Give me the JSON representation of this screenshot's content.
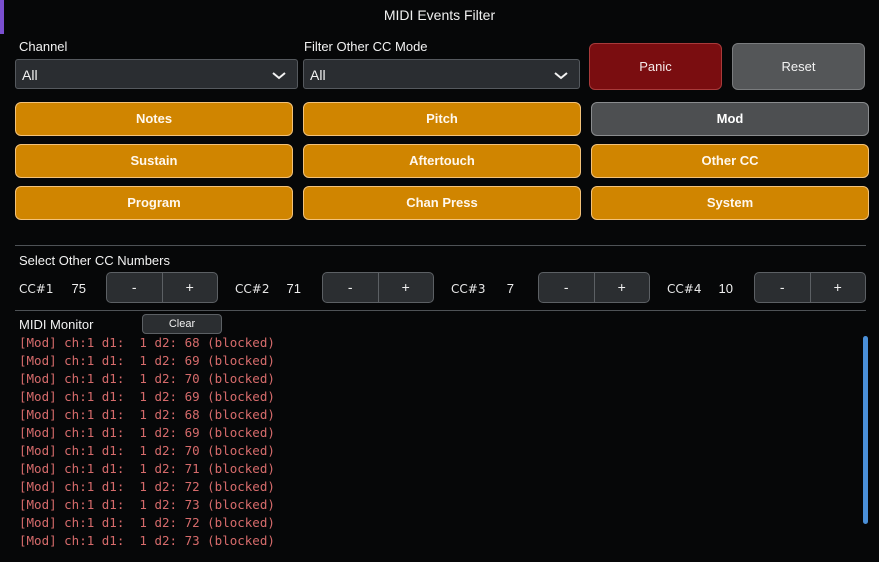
{
  "window": {
    "title": "MIDI Events Filter"
  },
  "channel": {
    "label": "Channel",
    "value": "All"
  },
  "cc_mode": {
    "label": "Filter Other CC Mode",
    "value": "All"
  },
  "actions": {
    "panic": "Panic",
    "reset": "Reset"
  },
  "toggles": [
    {
      "label": "Notes",
      "state": "on"
    },
    {
      "label": "Pitch",
      "state": "on"
    },
    {
      "label": "Mod",
      "state": "off"
    },
    {
      "label": "Sustain",
      "state": "on"
    },
    {
      "label": "Aftertouch",
      "state": "on"
    },
    {
      "label": "Other CC",
      "state": "on"
    },
    {
      "label": "Program",
      "state": "on"
    },
    {
      "label": "Chan Press",
      "state": "on"
    },
    {
      "label": "System",
      "state": "on"
    }
  ],
  "cc_section": {
    "title": "Select Other CC Numbers",
    "items": [
      {
        "label": "CC#1",
        "value": "75"
      },
      {
        "label": "CC#2",
        "value": "71"
      },
      {
        "label": "CC#3",
        "value": "7"
      },
      {
        "label": "CC#4",
        "value": "10"
      }
    ],
    "minus": "-",
    "plus": "+"
  },
  "monitor": {
    "title": "MIDI Monitor",
    "clear": "Clear",
    "lines": [
      "[Mod] ch:1 d1:  1 d2: 68 (blocked)",
      "[Mod] ch:1 d1:  1 d2: 69 (blocked)",
      "[Mod] ch:1 d1:  1 d2: 70 (blocked)",
      "[Mod] ch:1 d1:  1 d2: 69 (blocked)",
      "[Mod] ch:1 d1:  1 d2: 68 (blocked)",
      "[Mod] ch:1 d1:  1 d2: 69 (blocked)",
      "[Mod] ch:1 d1:  1 d2: 70 (blocked)",
      "[Mod] ch:1 d1:  1 d2: 71 (blocked)",
      "[Mod] ch:1 d1:  1 d2: 72 (blocked)",
      "[Mod] ch:1 d1:  1 d2: 73 (blocked)",
      "[Mod] ch:1 d1:  1 d2: 72 (blocked)",
      "[Mod] ch:1 d1:  1 d2: 73 (blocked)"
    ]
  },
  "colors": {
    "accent_on": "#d08500",
    "toggle_off": "#4d4f51",
    "panic": "#7a0d10",
    "monitor_text": "#d66b6b",
    "scrollbar": "#4a8fd8"
  }
}
